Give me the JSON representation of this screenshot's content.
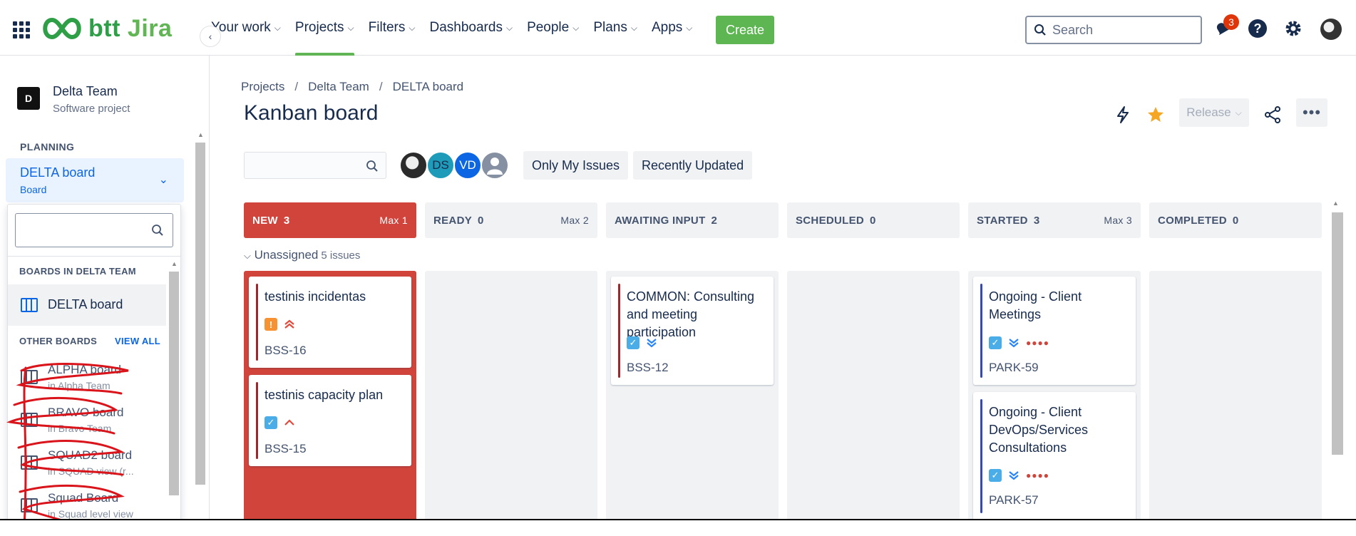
{
  "topnav": {
    "logo_text": "btt",
    "product": "Jira",
    "items": [
      {
        "label": "Your work",
        "active": false
      },
      {
        "label": "Projects",
        "active": true
      },
      {
        "label": "Filters",
        "active": false
      },
      {
        "label": "Dashboards",
        "active": false
      },
      {
        "label": "People",
        "active": false
      },
      {
        "label": "Plans",
        "active": false
      },
      {
        "label": "Apps",
        "active": false
      }
    ],
    "create_label": "Create",
    "search_placeholder": "Search",
    "notification_count": "3",
    "accent_color": "#62b555"
  },
  "sidebar": {
    "project_initial": "D",
    "project_name": "Delta Team",
    "project_type": "Software project",
    "section_planning": "PLANNING",
    "selected_board": "DELTA board",
    "selected_board_type": "Board"
  },
  "dropdown": {
    "boards_heading": "BOARDS IN DELTA TEAM",
    "current_board": "DELTA board",
    "other_heading": "OTHER BOARDS",
    "view_all": "VIEW ALL",
    "other_boards": [
      {
        "name": "ALPHA board",
        "sub": "in Alpha Team"
      },
      {
        "name": "BRAVO board",
        "sub": "in Bravo Team"
      },
      {
        "name": "SQUAD2 board",
        "sub": "in SQUAD view (r..."
      },
      {
        "name": "Squad Board",
        "sub": "in Squad level view"
      }
    ]
  },
  "main": {
    "breadcrumbs": [
      "Projects",
      "Delta Team",
      "DELTA board"
    ],
    "title": "Kanban board",
    "release_label": "Release",
    "avatars": [
      {
        "initials": "",
        "color": "#2b2b2b"
      },
      {
        "initials": "DS",
        "color": "#1d9bb9"
      },
      {
        "initials": "VD",
        "color": "#0c66e4"
      },
      {
        "initials": "",
        "color": "#8590a2"
      }
    ],
    "filters": [
      "Only My Issues",
      "Recently Updated"
    ],
    "swimlane_label": "Unassigned",
    "swimlane_count": "5 issues"
  },
  "columns": [
    {
      "name": "NEW",
      "count": "3",
      "max": "Max 1",
      "over": true
    },
    {
      "name": "READY",
      "count": "0",
      "max": "Max 2",
      "over": false
    },
    {
      "name": "AWAITING INPUT",
      "count": "2",
      "max": "",
      "over": false
    },
    {
      "name": "SCHEDULED",
      "count": "0",
      "max": "",
      "over": false
    },
    {
      "name": "STARTED",
      "count": "3",
      "max": "Max 3",
      "over": false
    },
    {
      "name": "COMPLETED",
      "count": "0",
      "max": "",
      "over": false
    }
  ],
  "cards": [
    {
      "title": "testinis incidentas",
      "key": "BSS-16",
      "bar_color": "#a2252c"
    },
    {
      "title": "testinis capacity plan",
      "key": "BSS-15",
      "bar_color": "#a2252c"
    },
    {
      "title": "COMMON: Consulting and meeting participation",
      "key": "BSS-12",
      "bar_color": "#a2252c"
    },
    {
      "title": "Ongoing - Client Meetings",
      "key": "PARK-59",
      "bar_color": "#3348c7"
    },
    {
      "title": "Ongoing - Client DevOps/Services Consultations",
      "key": "PARK-57",
      "bar_color": "#3348c7"
    }
  ]
}
